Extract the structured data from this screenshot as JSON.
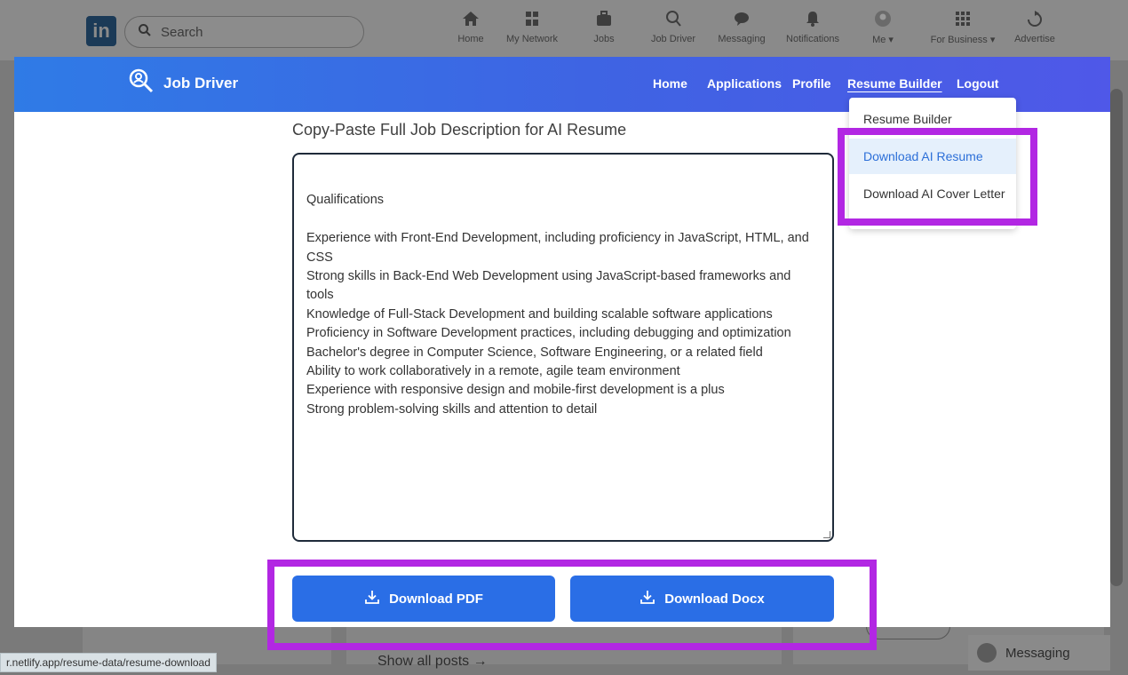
{
  "linkedin": {
    "logo": "in",
    "search_placeholder": "Search",
    "nav": [
      {
        "label": "Home",
        "icon": "home-icon"
      },
      {
        "label": "My Network",
        "icon": "network-icon"
      },
      {
        "label": "Jobs",
        "icon": "briefcase-icon"
      },
      {
        "label": "Job Driver",
        "icon": "job-driver-icon"
      },
      {
        "label": "Messaging",
        "icon": "messaging-icon"
      },
      {
        "label": "Notifications",
        "icon": "bell-icon"
      },
      {
        "label": "Me ▾",
        "icon": "avatar-icon"
      },
      {
        "label": "For Business ▾",
        "icon": "grid-icon"
      },
      {
        "label": "Advertise",
        "icon": "advertise-icon"
      }
    ],
    "show_all_posts": "Show all posts →",
    "messaging": "Messaging",
    "status_url": "r.netlify.app/resume-data/resume-download"
  },
  "app": {
    "brand": "Job Driver",
    "menu": [
      "Home",
      "Applications",
      "Profile",
      "Resume Builder",
      "Logout"
    ],
    "active_menu": "Resume Builder",
    "dropdown": [
      "Resume Builder",
      "Download AI Resume",
      "Download AI Cover Letter"
    ],
    "selected_dropdown": "Download AI Resume",
    "colors": {
      "header_start": "#2f7be6",
      "header_end": "#4f58e8",
      "button": "#2a6ee6",
      "highlight": "#b227e3"
    }
  },
  "form": {
    "label": "Copy-Paste Full Job Description for AI Resume",
    "job_description": "Qualifications\n\nExperience with Front-End Development, including proficiency in JavaScript, HTML, and CSS\nStrong skills in Back-End Web Development using JavaScript-based frameworks and tools\nKnowledge of Full-Stack Development and building scalable software applications\nProficiency in Software Development practices, including debugging and optimization\nBachelor's degree in Computer Science, Software Engineering, or a related field\nAbility to work collaboratively in a remote, agile team environment\nExperience with responsive design and mobile-first development is a plus\nStrong problem-solving skills and attention to detail",
    "download_pdf": "Download PDF",
    "download_docx": "Download Docx"
  }
}
